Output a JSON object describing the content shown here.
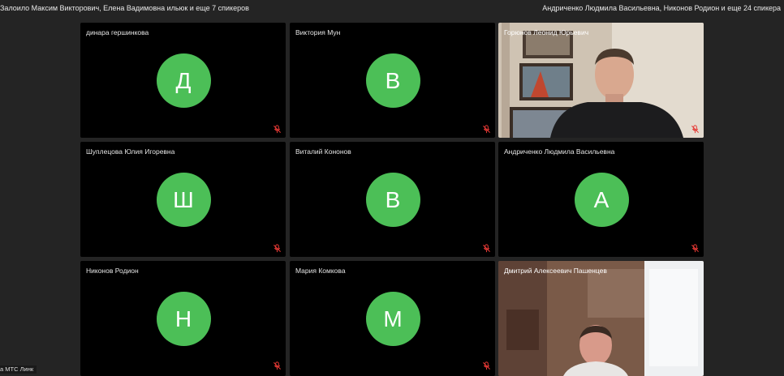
{
  "header": {
    "left_speakers": "Залоило Максим Викторович, Елена Вадимовна ильюк и еще 7 спикеров",
    "right_speakers": "Андриченко Людмила Васильевна, Никонов Родион и еще 24 спикера"
  },
  "tiles": [
    {
      "name": "динара гершинкова",
      "initial": "Д",
      "mic": "muted"
    },
    {
      "name": "Виктория Мун",
      "initial": "В",
      "mic": "muted"
    },
    {
      "name": "Горюнов Леонид Юрьевич",
      "initial": "",
      "mic": "muted"
    },
    {
      "name": "Шуплецова Юлия Игоревна",
      "initial": "Ш",
      "mic": "muted"
    },
    {
      "name": "Виталий Кононов",
      "initial": "В",
      "mic": "muted"
    },
    {
      "name": "Андриченко Людмила Васильевна",
      "initial": "А",
      "mic": "muted"
    },
    {
      "name": "Никонов Родион",
      "initial": "Н",
      "mic": "muted"
    },
    {
      "name": "Мария Комкова",
      "initial": "М",
      "mic": "muted"
    },
    {
      "name": "Дмитрий Алексеевич Пашенцев",
      "initial": "",
      "mic": "muted"
    }
  ],
  "footer": {
    "partial_label": "а МТС Линк"
  },
  "colors": {
    "background": "#242424",
    "tile": "#000000",
    "avatar": "#4cbf57",
    "mute_icon": "#e53935"
  }
}
